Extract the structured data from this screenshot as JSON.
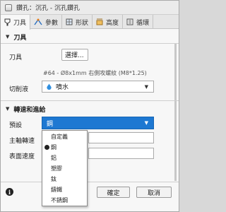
{
  "window": {
    "title": "鑽孔：沉孔 - 沉孔鑽孔"
  },
  "tabs": [
    {
      "label": "刀具",
      "icon": "tool-icon"
    },
    {
      "label": "參數",
      "icon": "parameters-icon"
    },
    {
      "label": "形狀",
      "icon": "geometry-icon"
    },
    {
      "label": "高度",
      "icon": "heights-icon"
    },
    {
      "label": "循環",
      "icon": "cycle-icon"
    }
  ],
  "tool_section": {
    "header": "刀具",
    "tool_label": "刀具",
    "select_button": "選擇...",
    "tool_description": "#64 - Ø8x1mm 右側攻螺紋 (M8*1.25)",
    "coolant_label": "切削液",
    "coolant_value": "噴水",
    "coolant_icon": "water-drop-icon"
  },
  "feed_section": {
    "header": "轉速和進給",
    "preset_label": "預設",
    "preset_value": "鋼",
    "spindle_label": "主軸轉速",
    "surface_label": "表面速度"
  },
  "preset_options": [
    "自定義",
    "鋼",
    "鋁",
    "塑膠",
    "鈦",
    "鑄鐵",
    "不銹鋼"
  ],
  "preset_selected_index": 1,
  "footer": {
    "ok_label": "確定",
    "cancel_label": "取消"
  },
  "colors": {
    "accent": "#1e78d2",
    "coolant_drop": "#2f8fe0"
  }
}
